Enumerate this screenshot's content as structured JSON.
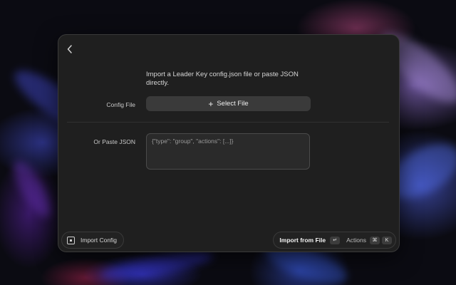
{
  "window": {
    "intro_text": "Import a Leader Key config.json file or paste JSON directly.",
    "config_file_label": "Config File",
    "select_file_label": "Select File",
    "paste_json_label": "Or Paste JSON",
    "paste_json_placeholder": "{\"type\": \"group\", \"actions\": [...]}"
  },
  "footer": {
    "import_config_label": "Import Config",
    "primary_action_label": "Import from File",
    "primary_action_key": "↵",
    "actions_label": "Actions",
    "actions_keys": [
      "⌘",
      "K"
    ]
  },
  "colors": {
    "window_bg": "#1f1f1f",
    "button_bg": "#3a3a3a",
    "text_primary": "#d6d6d6"
  },
  "icons": {
    "back": "chevron-left-icon",
    "add": "plus-icon",
    "extension": "extension-icon",
    "return_key": "return-key-icon",
    "command_key": "command-key-icon"
  }
}
